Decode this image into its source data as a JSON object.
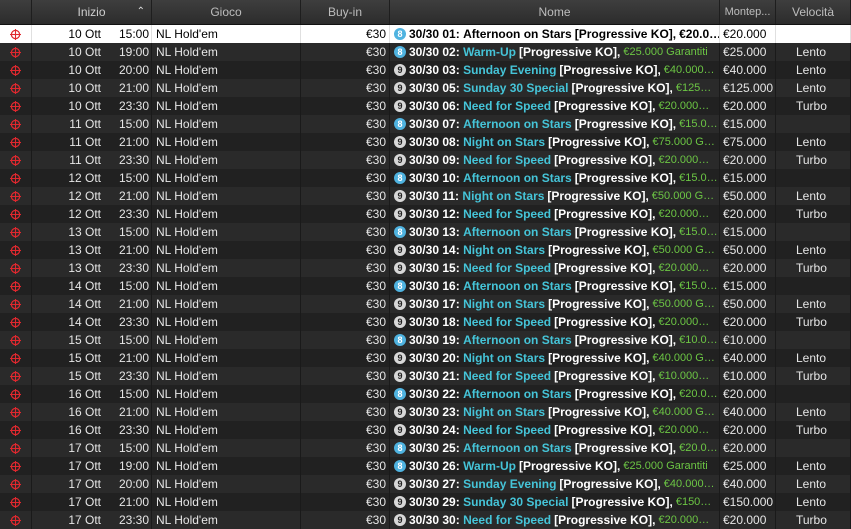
{
  "headers": {
    "icon": "",
    "start": "Inizio",
    "game": "Gioco",
    "buyin": "Buy-in",
    "name": "Nome",
    "prize": "Montep...",
    "speed": "Velocità"
  },
  "colors": {
    "target": "#e0282f",
    "title": "#45c4d8",
    "guarantee": "#6cc644"
  },
  "rows": [
    {
      "date": "10 Ott",
      "time": "15:00",
      "game": "NL Hold'em",
      "buyin": "€30",
      "badge": "8",
      "count": "30/30",
      "num": "01:",
      "title": "Afternoon on Stars",
      "type": "[Progressive KO],",
      "gtd": "€20.0…",
      "prize": "€20.000",
      "speed": ""
    },
    {
      "date": "10 Ott",
      "time": "19:00",
      "game": "NL Hold'em",
      "buyin": "€30",
      "badge": "8",
      "count": "30/30",
      "num": "02:",
      "title": "Warm-Up",
      "type": "[Progressive KO],",
      "gtd": "€25.000 Garantiti",
      "prize": "€25.000",
      "speed": "Lento"
    },
    {
      "date": "10 Ott",
      "time": "20:00",
      "game": "NL Hold'em",
      "buyin": "€30",
      "badge": "9",
      "count": "30/30",
      "num": "03:",
      "title": "Sunday Evening",
      "type": "[Progressive KO],",
      "gtd": "€40.000…",
      "prize": "€40.000",
      "speed": "Lento"
    },
    {
      "date": "10 Ott",
      "time": "21:00",
      "game": "NL Hold'em",
      "buyin": "€30",
      "badge": "9",
      "count": "30/30",
      "num": "05:",
      "title": "Sunday 30 Special",
      "type": "[Progressive KO],",
      "gtd": "€125…",
      "prize": "€125.000",
      "speed": "Lento"
    },
    {
      "date": "10 Ott",
      "time": "23:30",
      "game": "NL Hold'em",
      "buyin": "€30",
      "badge": "9",
      "count": "30/30",
      "num": "06:",
      "title": "Need for Speed",
      "type": "[Progressive KO],",
      "gtd": "€20.000…",
      "prize": "€20.000",
      "speed": "Turbo"
    },
    {
      "date": "11 Ott",
      "time": "15:00",
      "game": "NL Hold'em",
      "buyin": "€30",
      "badge": "8",
      "count": "30/30",
      "num": "07:",
      "title": "Afternoon on Stars",
      "type": "[Progressive KO],",
      "gtd": "€15.0…",
      "prize": "€15.000",
      "speed": ""
    },
    {
      "date": "11 Ott",
      "time": "21:00",
      "game": "NL Hold'em",
      "buyin": "€30",
      "badge": "9",
      "count": "30/30",
      "num": "08:",
      "title": "Night on Stars",
      "type": "[Progressive KO],",
      "gtd": "€75.000 G…",
      "prize": "€75.000",
      "speed": "Lento"
    },
    {
      "date": "11 Ott",
      "time": "23:30",
      "game": "NL Hold'em",
      "buyin": "€30",
      "badge": "9",
      "count": "30/30",
      "num": "09:",
      "title": "Need for Speed",
      "type": "[Progressive KO],",
      "gtd": "€20.000…",
      "prize": "€20.000",
      "speed": "Turbo"
    },
    {
      "date": "12 Ott",
      "time": "15:00",
      "game": "NL Hold'em",
      "buyin": "€30",
      "badge": "8",
      "count": "30/30",
      "num": "10:",
      "title": "Afternoon on Stars",
      "type": "[Progressive KO],",
      "gtd": "€15.0…",
      "prize": "€15.000",
      "speed": ""
    },
    {
      "date": "12 Ott",
      "time": "21:00",
      "game": "NL Hold'em",
      "buyin": "€30",
      "badge": "9",
      "count": "30/30",
      "num": "11:",
      "title": "Night on Stars",
      "type": "[Progressive KO],",
      "gtd": "€50.000 G…",
      "prize": "€50.000",
      "speed": "Lento"
    },
    {
      "date": "12 Ott",
      "time": "23:30",
      "game": "NL Hold'em",
      "buyin": "€30",
      "badge": "9",
      "count": "30/30",
      "num": "12:",
      "title": "Need for Speed",
      "type": "[Progressive KO],",
      "gtd": "€20.000…",
      "prize": "€20.000",
      "speed": "Turbo"
    },
    {
      "date": "13 Ott",
      "time": "15:00",
      "game": "NL Hold'em",
      "buyin": "€30",
      "badge": "8",
      "count": "30/30",
      "num": "13:",
      "title": "Afternoon on Stars",
      "type": "[Progressive KO],",
      "gtd": "€15.0…",
      "prize": "€15.000",
      "speed": ""
    },
    {
      "date": "13 Ott",
      "time": "21:00",
      "game": "NL Hold'em",
      "buyin": "€30",
      "badge": "9",
      "count": "30/30",
      "num": "14:",
      "title": "Night on Stars",
      "type": "[Progressive KO],",
      "gtd": "€50.000 G…",
      "prize": "€50.000",
      "speed": "Lento"
    },
    {
      "date": "13 Ott",
      "time": "23:30",
      "game": "NL Hold'em",
      "buyin": "€30",
      "badge": "9",
      "count": "30/30",
      "num": "15:",
      "title": "Need for Speed",
      "type": "[Progressive KO],",
      "gtd": "€20.000…",
      "prize": "€20.000",
      "speed": "Turbo"
    },
    {
      "date": "14 Ott",
      "time": "15:00",
      "game": "NL Hold'em",
      "buyin": "€30",
      "badge": "8",
      "count": "30/30",
      "num": "16:",
      "title": "Afternoon on Stars",
      "type": "[Progressive KO],",
      "gtd": "€15.0…",
      "prize": "€15.000",
      "speed": ""
    },
    {
      "date": "14 Ott",
      "time": "21:00",
      "game": "NL Hold'em",
      "buyin": "€30",
      "badge": "9",
      "count": "30/30",
      "num": "17:",
      "title": "Night on Stars",
      "type": "[Progressive KO],",
      "gtd": "€50.000 G…",
      "prize": "€50.000",
      "speed": "Lento"
    },
    {
      "date": "14 Ott",
      "time": "23:30",
      "game": "NL Hold'em",
      "buyin": "€30",
      "badge": "9",
      "count": "30/30",
      "num": "18:",
      "title": "Need for Speed",
      "type": "[Progressive KO],",
      "gtd": "€20.000…",
      "prize": "€20.000",
      "speed": "Turbo"
    },
    {
      "date": "15 Ott",
      "time": "15:00",
      "game": "NL Hold'em",
      "buyin": "€30",
      "badge": "8",
      "count": "30/30",
      "num": "19:",
      "title": "Afternoon on Stars",
      "type": "[Progressive KO],",
      "gtd": "€10.0…",
      "prize": "€10.000",
      "speed": ""
    },
    {
      "date": "15 Ott",
      "time": "21:00",
      "game": "NL Hold'em",
      "buyin": "€30",
      "badge": "9",
      "count": "30/30",
      "num": "20:",
      "title": "Night on Stars",
      "type": "[Progressive KO],",
      "gtd": "€40.000 G…",
      "prize": "€40.000",
      "speed": "Lento"
    },
    {
      "date": "15 Ott",
      "time": "23:30",
      "game": "NL Hold'em",
      "buyin": "€30",
      "badge": "9",
      "count": "30/30",
      "num": "21:",
      "title": "Need for Speed",
      "type": "[Progressive KO],",
      "gtd": "€10.000…",
      "prize": "€10.000",
      "speed": "Turbo"
    },
    {
      "date": "16 Ott",
      "time": "15:00",
      "game": "NL Hold'em",
      "buyin": "€30",
      "badge": "8",
      "count": "30/30",
      "num": "22:",
      "title": "Afternoon on Stars",
      "type": "[Progressive KO],",
      "gtd": "€20.0…",
      "prize": "€20.000",
      "speed": ""
    },
    {
      "date": "16 Ott",
      "time": "21:00",
      "game": "NL Hold'em",
      "buyin": "€30",
      "badge": "9",
      "count": "30/30",
      "num": "23:",
      "title": "Night on Stars",
      "type": "[Progressive KO],",
      "gtd": "€40.000 G…",
      "prize": "€40.000",
      "speed": "Lento"
    },
    {
      "date": "16 Ott",
      "time": "23:30",
      "game": "NL Hold'em",
      "buyin": "€30",
      "badge": "9",
      "count": "30/30",
      "num": "24:",
      "title": "Need for Speed",
      "type": "[Progressive KO],",
      "gtd": "€20.000…",
      "prize": "€20.000",
      "speed": "Turbo"
    },
    {
      "date": "17 Ott",
      "time": "15:00",
      "game": "NL Hold'em",
      "buyin": "€30",
      "badge": "8",
      "count": "30/30",
      "num": "25:",
      "title": "Afternoon on Stars",
      "type": "[Progressive KO],",
      "gtd": "€20.0…",
      "prize": "€20.000",
      "speed": ""
    },
    {
      "date": "17 Ott",
      "time": "19:00",
      "game": "NL Hold'em",
      "buyin": "€30",
      "badge": "8",
      "count": "30/30",
      "num": "26:",
      "title": "Warm-Up",
      "type": "[Progressive KO],",
      "gtd": "€25.000 Garantiti",
      "prize": "€25.000",
      "speed": "Lento"
    },
    {
      "date": "17 Ott",
      "time": "20:00",
      "game": "NL Hold'em",
      "buyin": "€30",
      "badge": "9",
      "count": "30/30",
      "num": "27:",
      "title": "Sunday Evening",
      "type": "[Progressive KO],",
      "gtd": "€40.000…",
      "prize": "€40.000",
      "speed": "Lento"
    },
    {
      "date": "17 Ott",
      "time": "21:00",
      "game": "NL Hold'em",
      "buyin": "€30",
      "badge": "9",
      "count": "30/30",
      "num": "29:",
      "title": "Sunday 30 Special",
      "type": "[Progressive KO],",
      "gtd": "€150…",
      "prize": "€150.000",
      "speed": "Lento"
    },
    {
      "date": "17 Ott",
      "time": "23:30",
      "game": "NL Hold'em",
      "buyin": "€30",
      "badge": "9",
      "count": "30/30",
      "num": "30:",
      "title": "Need for Speed",
      "type": "[Progressive KO],",
      "gtd": "€20.000…",
      "prize": "€20.000",
      "speed": "Turbo"
    }
  ]
}
